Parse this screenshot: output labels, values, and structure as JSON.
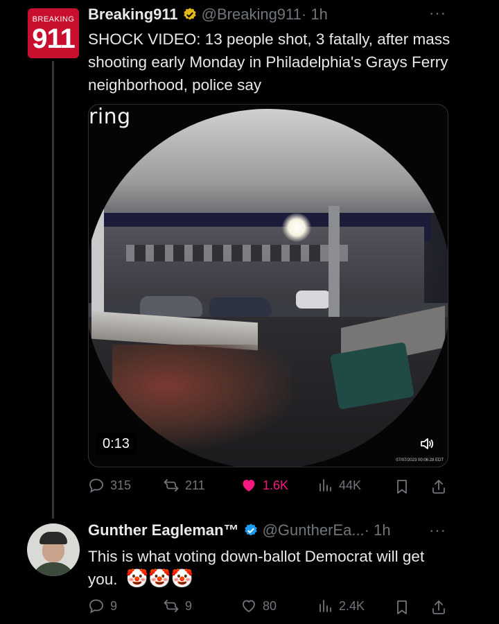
{
  "tweet": {
    "avatar_text_small": "BREAKING",
    "avatar_text_big": "911",
    "name": "Breaking911",
    "handle": "@Breaking911",
    "time": "· 1h",
    "more": "···",
    "text": "SHOCK VIDEO: 13 people shot, 3 fatally, after mass shooting early Monday in Philadelphia's Grays Ferry neighborhood, police say",
    "media": {
      "brand": "ring",
      "duration": "0:13",
      "timestamp": "07/07/2023 00:06:28 EDT",
      "sound_icon": "speaker-icon"
    },
    "stats": {
      "replies": "315",
      "reposts": "211",
      "likes": "1.6K",
      "views": "44K"
    }
  },
  "reply": {
    "name": "Gunther Eagleman™",
    "handle": "@GuntherEa...",
    "time": "· 1h",
    "more": "···",
    "text": "This is what voting down-ballot Democrat will get you.",
    "emojis": "🤡🤡🤡",
    "stats": {
      "replies": "9",
      "reposts": "9",
      "likes": "80",
      "views": "2.4K"
    }
  },
  "colors": {
    "background": "#000000",
    "text": "#e7e9ea",
    "muted": "#71767b",
    "verified_gold": "#e2b719",
    "verified_blue": "#1d9bf0",
    "like_pink": "#f91880"
  }
}
